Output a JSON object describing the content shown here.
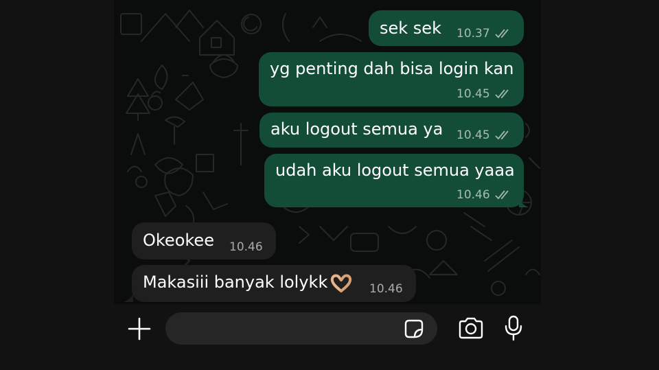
{
  "messages": [
    {
      "direction": "outgoing",
      "text": "sek sek",
      "time": "10.37",
      "status": "read"
    },
    {
      "direction": "outgoing",
      "text": "yg penting dah bisa login kan",
      "time": "10.45",
      "status": "read"
    },
    {
      "direction": "outgoing",
      "text": "aku logout semua ya",
      "time": "10.45",
      "status": "read"
    },
    {
      "direction": "outgoing",
      "text": "udah aku logout semua yaaa",
      "time": "10.46",
      "status": "read"
    },
    {
      "direction": "incoming",
      "text": "Okeokee",
      "time": "10.46"
    },
    {
      "direction": "incoming",
      "text": "Makasiii banyak lolykk",
      "emoji": "heart-hands",
      "time": "10.46"
    }
  ],
  "composer": {
    "left_icon": "plus-icon",
    "right_icons": [
      "sticker-icon",
      "camera-icon",
      "microphone-icon"
    ]
  },
  "colors": {
    "outgoing_bubble": "#144d37",
    "incoming_bubble": "#1f1f1f",
    "chat_background": "#0b0c0c"
  }
}
